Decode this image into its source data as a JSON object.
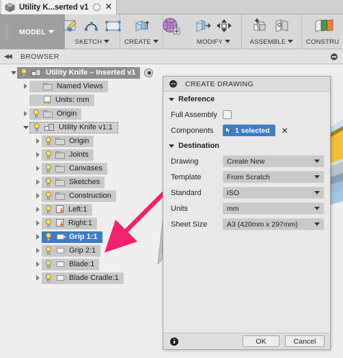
{
  "titlebar": {
    "tab_title": "Utility K...serted v1",
    "doc_icon": "cube-icon",
    "status_dot": "unsaved-indicator",
    "close_label": "✕"
  },
  "ribbon": {
    "workspace": {
      "label": "MODEL",
      "caret": "▼"
    },
    "groups": [
      {
        "label": "SKETCH",
        "caret": "▼"
      },
      {
        "label": "CREATE",
        "caret": "▼"
      },
      {
        "label": "MODIFY",
        "caret": "▼"
      },
      {
        "label": "ASSEMBLE",
        "caret": "▼"
      },
      {
        "label": "CONSTRU",
        "caret": ""
      }
    ]
  },
  "browser": {
    "header": "BROWSER",
    "collapse_icon": "collapse-left-icon",
    "minimize_icon": "minimize-icon",
    "tree": [
      {
        "label": "Utility Knife – Inserted v1",
        "icon": "assembly-icon",
        "depth": 0,
        "disclosure": "down",
        "bulb": "on",
        "state": "root",
        "eye": true
      },
      {
        "label": "Named Views",
        "icon": "folder-icon",
        "depth": 1,
        "disclosure": "right",
        "bulb": "none",
        "state": "normal"
      },
      {
        "label": "Units: mm",
        "icon": "document-icon",
        "depth": 1,
        "disclosure": "none",
        "bulb": "none",
        "state": "normal"
      },
      {
        "label": "Origin",
        "icon": "folder-icon",
        "depth": 1,
        "disclosure": "right",
        "bulb": "on",
        "state": "normal"
      },
      {
        "label": "Utility Knife v1:1",
        "icon": "assembly-icon",
        "depth": 1,
        "disclosure": "down",
        "bulb": "on",
        "state": "dashed"
      },
      {
        "label": "Origin",
        "icon": "folder-icon",
        "depth": 2,
        "disclosure": "right",
        "bulb": "on",
        "state": "normal"
      },
      {
        "label": "Joints",
        "icon": "folder-icon",
        "depth": 2,
        "disclosure": "right",
        "bulb": "on",
        "state": "normal"
      },
      {
        "label": "Canvases",
        "icon": "folder-icon",
        "depth": 2,
        "disclosure": "right",
        "bulb": "on",
        "state": "normal"
      },
      {
        "label": "Sketches",
        "icon": "folder-icon",
        "depth": 2,
        "disclosure": "right",
        "bulb": "on",
        "state": "normal"
      },
      {
        "label": "Construction",
        "icon": "folder-icon",
        "depth": 2,
        "disclosure": "right",
        "bulb": "on",
        "state": "normal"
      },
      {
        "label": "Left:1",
        "icon": "plane-icon",
        "depth": 2,
        "disclosure": "right",
        "bulb": "on",
        "state": "normal"
      },
      {
        "label": "Right:1",
        "icon": "plane-icon",
        "depth": 2,
        "disclosure": "right",
        "bulb": "on",
        "state": "normal"
      },
      {
        "label": "Grip 1:1",
        "icon": "component-icon",
        "depth": 2,
        "disclosure": "right",
        "bulb": "on",
        "state": "selected"
      },
      {
        "label": "Grip 2:1",
        "icon": "component-icon",
        "depth": 2,
        "disclosure": "right",
        "bulb": "on",
        "state": "normal"
      },
      {
        "label": "Blade:1",
        "icon": "component-icon",
        "depth": 2,
        "disclosure": "right",
        "bulb": "on",
        "state": "normal"
      },
      {
        "label": "Blade Cradle:1",
        "icon": "component-icon",
        "depth": 2,
        "disclosure": "right",
        "bulb": "on",
        "state": "normal"
      }
    ]
  },
  "dialog": {
    "title": "CREATE DRAWING",
    "sections": {
      "reference": "Reference",
      "destination": "Destination"
    },
    "full_assembly": {
      "label": "Full Assembly",
      "checked": false
    },
    "components": {
      "label": "Components",
      "value": "1 selected",
      "clear_label": "✕",
      "cursor_icon": "select-cursor-icon"
    },
    "fields": [
      {
        "label": "Drawing",
        "value": "Create New"
      },
      {
        "label": "Template",
        "value": "From Scratch"
      },
      {
        "label": "Standard",
        "value": "ISO"
      },
      {
        "label": "Units",
        "value": "mm"
      },
      {
        "label": "Sheet Size",
        "value": "A3 (420mm x 297mm)"
      }
    ],
    "footer": {
      "info_icon": "info-icon",
      "ok": "OK",
      "cancel": "Cancel"
    }
  },
  "annotation": {
    "arrow_color": "#f2226e",
    "from": "components-field",
    "to": "tree-item-grip-1-1"
  },
  "colors": {
    "selection_blue": "#3f7cc4",
    "annotation_pink": "#f2226e",
    "ribbon_bg": "#d8d8d8",
    "panel_bg": "#e8e8e8",
    "row_bg": "#c9c9c9"
  }
}
